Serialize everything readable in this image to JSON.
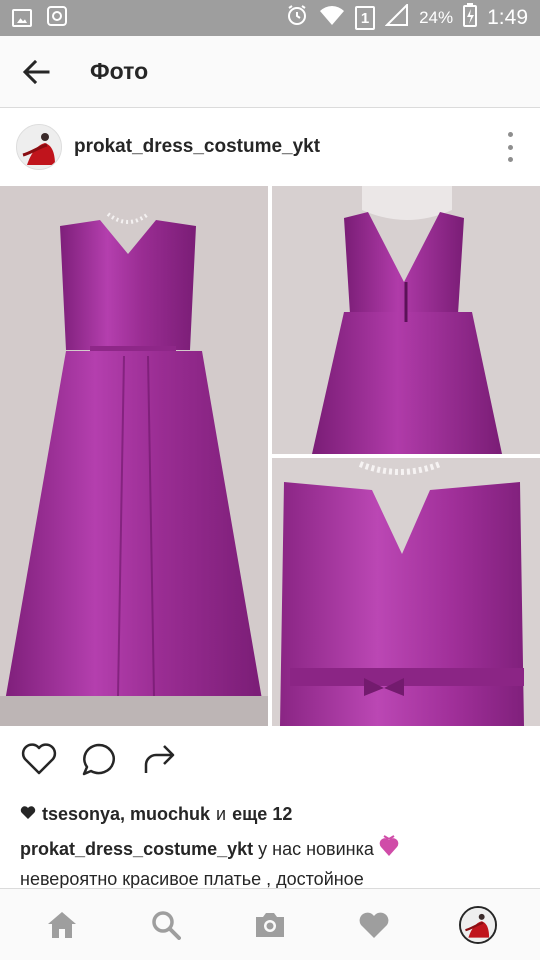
{
  "status_bar": {
    "battery_percent": "24%",
    "time": "1:49",
    "sim_slot": "1",
    "icons": [
      "image-icon",
      "app-icon",
      "alarm-icon",
      "wifi-icon",
      "sim-icon",
      "signal-icon",
      "battery-charging-icon"
    ]
  },
  "header": {
    "title": "Фото",
    "back_icon": "arrow-left-icon"
  },
  "post": {
    "username": "prokat_dress_costume_ykt",
    "avatar_icon": "red-dress-avatar",
    "more_icon": "more-vertical-icon",
    "photos": [
      {
        "name": "dress-front-photo"
      },
      {
        "name": "dress-back-photo"
      },
      {
        "name": "dress-detail-photo"
      }
    ],
    "actions": [
      {
        "name": "like",
        "icon": "heart-outline-icon"
      },
      {
        "name": "comment",
        "icon": "speech-bubble-icon"
      },
      {
        "name": "share",
        "icon": "share-arrow-icon"
      }
    ],
    "likes": {
      "names": "tsesonya, muochuk",
      "conjunction": "и",
      "more": "еще 12"
    },
    "caption": {
      "username": "prokat_dress_costume_ykt",
      "text": " у нас новинка",
      "emoji": "💓",
      "line2": "невероятно красивое платье , достойное"
    }
  },
  "bottom_nav": [
    {
      "name": "home",
      "icon": "home-icon"
    },
    {
      "name": "search",
      "icon": "search-icon"
    },
    {
      "name": "camera",
      "icon": "camera-icon"
    },
    {
      "name": "activity",
      "icon": "heart-icon"
    },
    {
      "name": "profile",
      "icon": "profile-avatar"
    }
  ],
  "colors": {
    "status_bar": "#9e9e9e",
    "header_bg": "#fafafa",
    "text": "#262626",
    "icon_gray": "#8e8e8e",
    "dress": "#a7339f",
    "wall": "#cfc7c7",
    "emoji_heart": "#d04ca8"
  }
}
